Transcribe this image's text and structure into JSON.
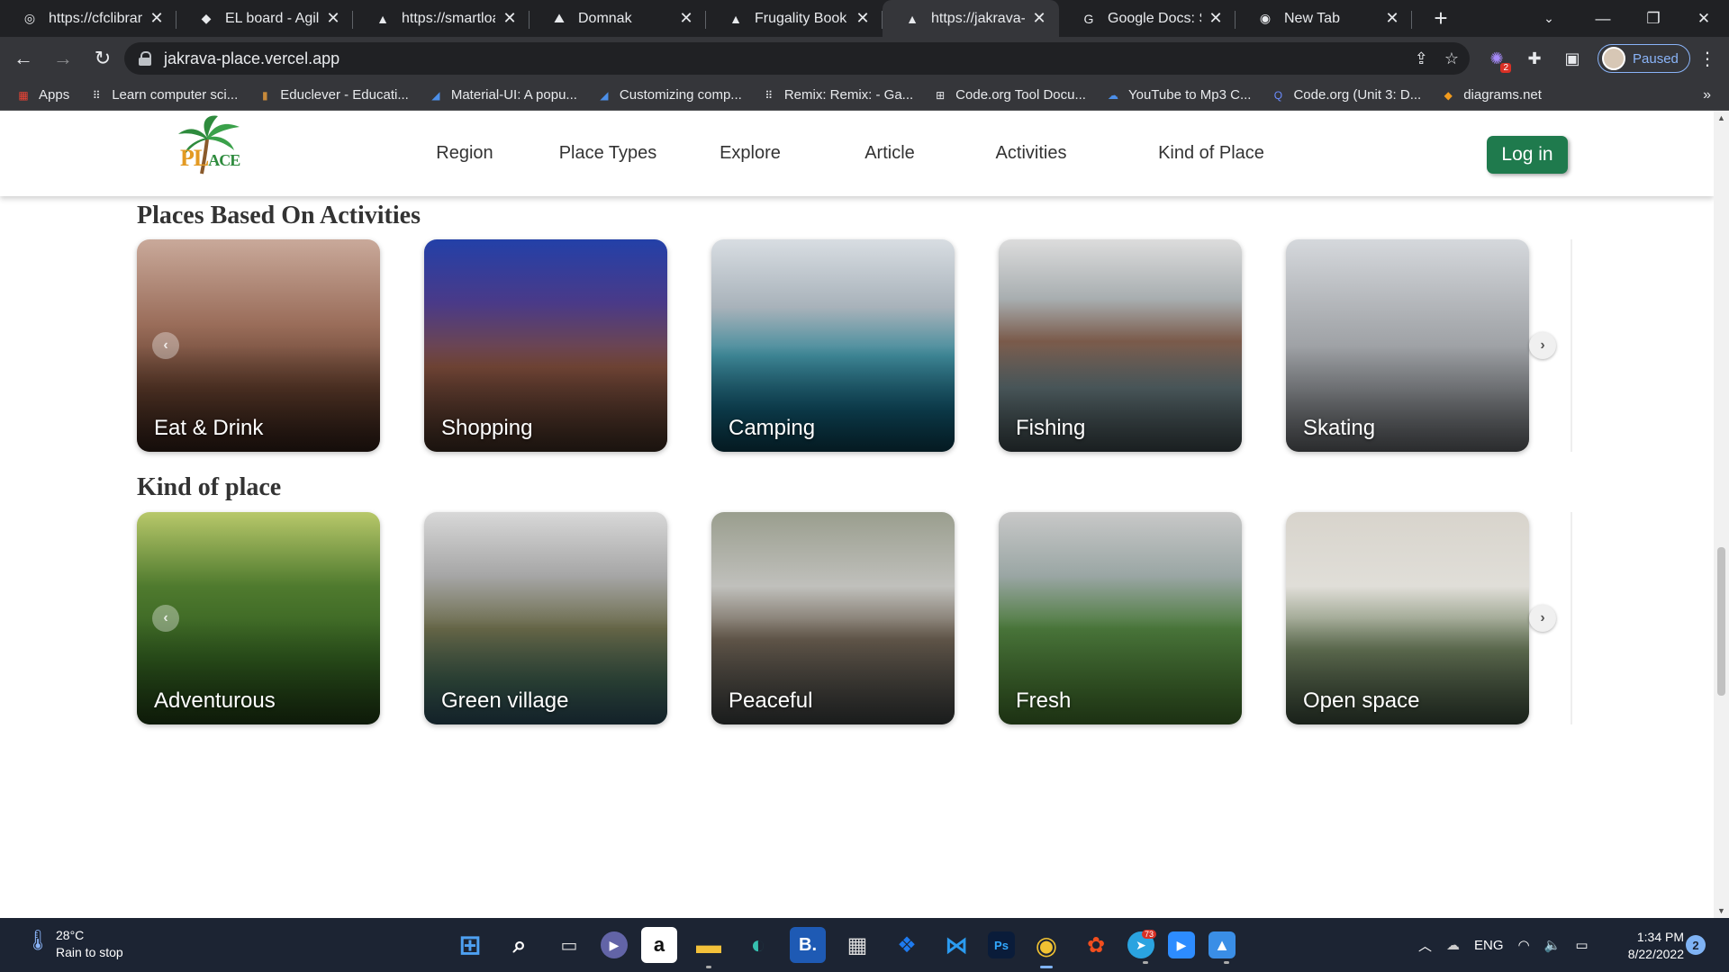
{
  "tabs": [
    {
      "title": "https://cfclibrary.",
      "icon": "globe-icon",
      "glyph": "◎"
    },
    {
      "title": "EL board - Agile b",
      "icon": "jira-icon",
      "glyph": "◆"
    },
    {
      "title": "https://smartload",
      "icon": "vercel-icon",
      "glyph": "▲"
    },
    {
      "title": "Domnak",
      "icon": "domnak-icon",
      "glyph": "⛰"
    },
    {
      "title": "Frugality Book",
      "icon": "vercel-icon",
      "glyph": "▲"
    },
    {
      "title": "https://jakrava-pl",
      "icon": "vercel-icon",
      "glyph": "▲",
      "active": true
    },
    {
      "title": "Google Docs: Sig",
      "icon": "google-icon",
      "glyph": "G"
    },
    {
      "title": "New Tab",
      "icon": "chrome-icon",
      "glyph": "◉"
    }
  ],
  "toolbar": {
    "url": "jakrava-place.vercel.app",
    "profile_status": "Paused",
    "extension_badge": "2"
  },
  "bookmarks": [
    {
      "label": "Apps",
      "icon": "apps-grid-icon",
      "glyph": "▦",
      "color": "#ea4335"
    },
    {
      "label": "Learn computer sci...",
      "icon": "code-icon",
      "glyph": "⠿",
      "color": "#e8eaed"
    },
    {
      "label": "Educlever - Educati...",
      "icon": "book-icon",
      "glyph": "▮",
      "color": "#c78a3a"
    },
    {
      "label": "Material-UI: A popu...",
      "icon": "mui-icon",
      "glyph": "◢",
      "color": "#4c8fe8"
    },
    {
      "label": "Customizing comp...",
      "icon": "mui-icon",
      "glyph": "◢",
      "color": "#4c8fe8"
    },
    {
      "label": "Remix: Remix: - Ga...",
      "icon": "code-icon",
      "glyph": "⠿",
      "color": "#e8eaed"
    },
    {
      "label": "Code.org Tool Docu...",
      "icon": "codeorg-icon",
      "glyph": "⊞",
      "color": "#e8eaed"
    },
    {
      "label": "YouTube to Mp3 C...",
      "icon": "cloud-download-icon",
      "glyph": "☁",
      "color": "#4c8fe8"
    },
    {
      "label": "Code.org (Unit 3: D...",
      "icon": "search-q-icon",
      "glyph": "Q",
      "color": "#6b8cff"
    },
    {
      "label": "diagrams.net",
      "icon": "diagrams-icon",
      "glyph": "◆",
      "color": "#f29b1d"
    }
  ],
  "site": {
    "logo_text": "PL",
    "logo_ace": "ACE",
    "nav": [
      "Region",
      "Place Types",
      "Explore",
      "Article",
      "Activities",
      "Kind of Place"
    ],
    "login": "Log in"
  },
  "sections": [
    {
      "title": "Places Based On Activities",
      "cards": [
        {
          "label": "Eat & Drink"
        },
        {
          "label": "Shopping"
        },
        {
          "label": "Camping"
        },
        {
          "label": "Fishing"
        },
        {
          "label": "Skating"
        }
      ]
    },
    {
      "title": "Kind of place",
      "cards": [
        {
          "label": "Adventurous"
        },
        {
          "label": "Green village"
        },
        {
          "label": "Peaceful"
        },
        {
          "label": "Fresh"
        },
        {
          "label": "Open space"
        }
      ]
    }
  ],
  "taskbar": {
    "temp": "28°C",
    "weather": "Rain to stop",
    "lang": "ENG",
    "time": "1:34 PM",
    "date": "8/22/2022",
    "notifications": "2",
    "telegram_badge": "73"
  }
}
